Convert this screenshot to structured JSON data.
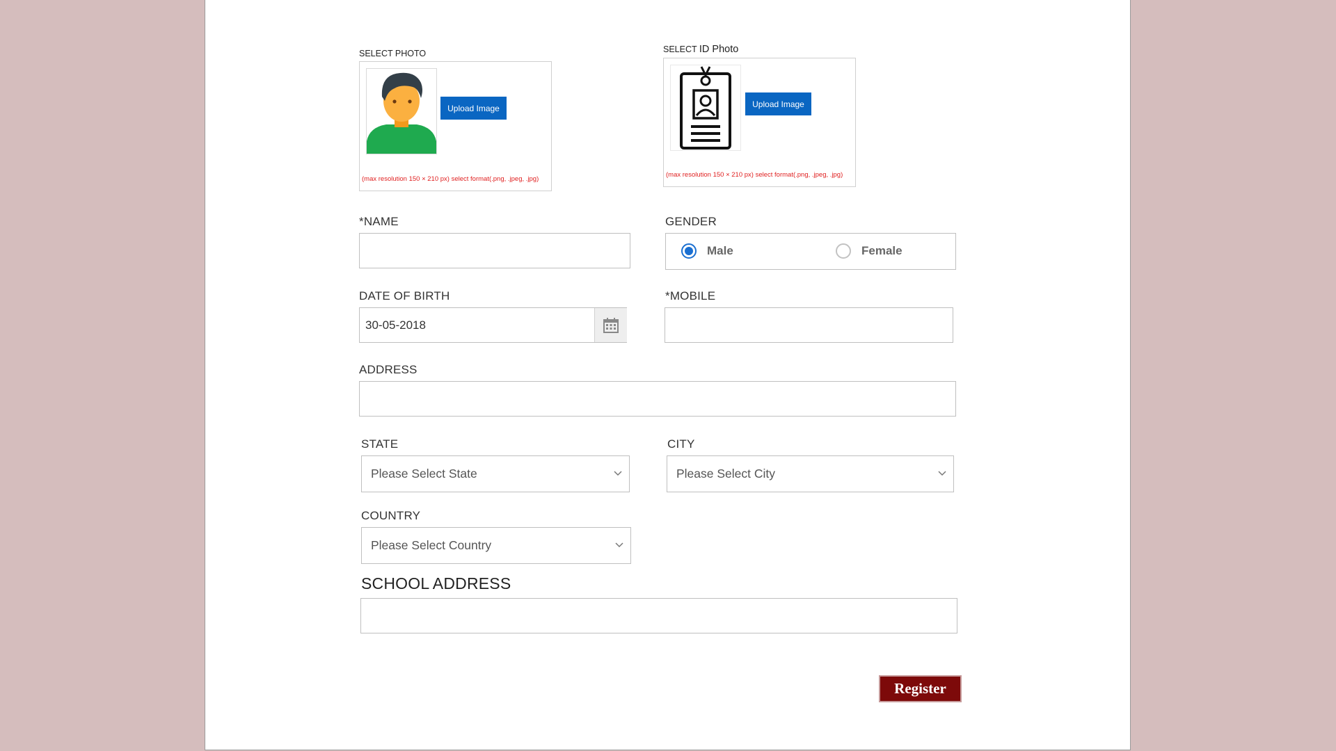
{
  "photo": {
    "label": "SELECT PHOTO",
    "upload_label": "Upload Image",
    "hint": "(max resolution 150 × 210 px) select format(.png, .jpeg, .jpg)",
    "avatar_icon": "person-avatar-icon"
  },
  "id_photo": {
    "label_prefix": "SELECT",
    "label_suffix": "ID Photo",
    "upload_label": "Upload Image",
    "hint": "(max resolution 150 × 210 px) select format(.png, .jpeg, .jpg)",
    "badge_icon": "id-badge-icon"
  },
  "form": {
    "name_label": "*NAME",
    "name_value": "",
    "gender_label": "GENDER",
    "gender_options": [
      "Male",
      "Female"
    ],
    "gender_selected": "Male",
    "dob_label": "DATE OF BIRTH",
    "dob_value": "30-05-2018",
    "mobile_label": "*MOBILE",
    "mobile_value": "",
    "address_label": "ADDRESS",
    "address_value": "",
    "state_label": "STATE",
    "state_placeholder": "Please Select State",
    "city_label": "CITY",
    "city_placeholder": "Please Select City",
    "country_label": "COUNTRY",
    "country_placeholder": "Please Select Country",
    "school_address_label": "SCHOOL ADDRESS",
    "school_address_value": "",
    "register_label": "Register"
  },
  "colors": {
    "page_bg": "#d5bdbd",
    "upload_button": "#0a66c2",
    "hint_text": "#e02020",
    "radio_selected": "#1a6fd1",
    "register_button": "#7d0a0a"
  }
}
